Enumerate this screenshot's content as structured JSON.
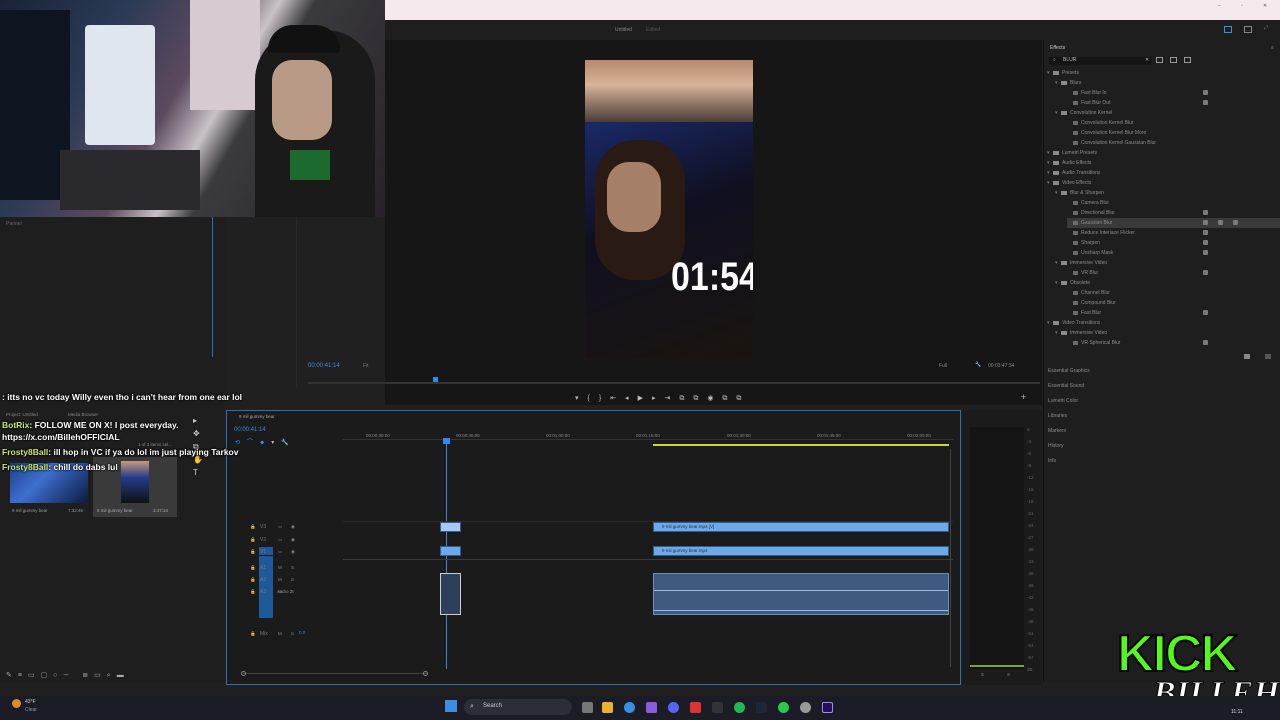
{
  "window": {
    "title": "Untitled",
    "subtitle": "Edited"
  },
  "program_monitor": {
    "timecode": "00:00:41:14",
    "fit_label": "Fit",
    "full_label": "Full",
    "duration": "00:03:47:34",
    "overlay_timer": "01:54"
  },
  "effects_panel": {
    "title": "Effects",
    "search_value": "BLUR",
    "items": [
      {
        "label": "Presets",
        "kind": "folder",
        "level": 0
      },
      {
        "label": "Blurs",
        "kind": "folder",
        "level": 1
      },
      {
        "label": "Fast Blur In",
        "kind": "item",
        "level": 2,
        "badge": true
      },
      {
        "label": "Fast Blur Out",
        "kind": "item",
        "level": 2,
        "badge": true
      },
      {
        "label": "Convolution Kernel",
        "kind": "folder",
        "level": 1
      },
      {
        "label": "Convolution Kernel Blur",
        "kind": "item",
        "level": 2
      },
      {
        "label": "Convolution Kernel Blur More",
        "kind": "item",
        "level": 2
      },
      {
        "label": "Convolution Kernel Gaussian Blur",
        "kind": "item",
        "level": 2
      },
      {
        "label": "Lumetri Presets",
        "kind": "folder",
        "level": 0
      },
      {
        "label": "Audio Effects",
        "kind": "folder",
        "level": 0
      },
      {
        "label": "Audio Transitions",
        "kind": "folder",
        "level": 0
      },
      {
        "label": "Video Effects",
        "kind": "folder",
        "level": 0
      },
      {
        "label": "Blur & Sharpen",
        "kind": "folder",
        "level": 1
      },
      {
        "label": "Camera Blur",
        "kind": "item",
        "level": 2
      },
      {
        "label": "Directional Blur",
        "kind": "item",
        "level": 2,
        "badge": true
      },
      {
        "label": "Gaussian Blur",
        "kind": "item",
        "level": 2,
        "badge": true,
        "selected": true
      },
      {
        "label": "Reduce Interlace Flicker",
        "kind": "item",
        "level": 2,
        "badge": true
      },
      {
        "label": "Sharpen",
        "kind": "item",
        "level": 2,
        "badge": true
      },
      {
        "label": "Unsharp Mask",
        "kind": "item",
        "level": 2,
        "badge": true
      },
      {
        "label": "Immersive Video",
        "kind": "folder",
        "level": 1
      },
      {
        "label": "VR Blur",
        "kind": "item",
        "level": 2,
        "badge": true
      },
      {
        "label": "Obsolete",
        "kind": "folder",
        "level": 1
      },
      {
        "label": "Channel Blur",
        "kind": "item",
        "level": 2
      },
      {
        "label": "Compound Blur",
        "kind": "item",
        "level": 2
      },
      {
        "label": "Fast Blur",
        "kind": "item",
        "level": 2,
        "badge": true
      },
      {
        "label": "Video Transitions",
        "kind": "folder",
        "level": 0
      },
      {
        "label": "Immersive Video",
        "kind": "folder",
        "level": 1
      },
      {
        "label": "VR Spherical Blur",
        "kind": "item",
        "level": 2,
        "badge": true
      }
    ]
  },
  "side_panels": [
    "Essential Graphics",
    "Essential Sound",
    "Lumetri Color",
    "Libraries",
    "Markers",
    "History",
    "Info"
  ],
  "project_panel": {
    "tabs": [
      "Project: Untitled",
      "Media Browser"
    ],
    "items_count": "1 of 3 items sel...",
    "bins": [
      {
        "name": "9 mil gummy bear",
        "duration": "7:32:46"
      },
      {
        "name": "9 mil gummy bear",
        "duration": "3:47:34"
      }
    ]
  },
  "panner_label": "Panner",
  "timeline": {
    "tab": "9 mil gummy bear",
    "timecode": "00:00:41:14",
    "ruler": [
      "00:00:30:00",
      "00:00:45:00",
      "00:01:00:00",
      "00:01:15:00",
      "00:01:30:00",
      "00:01:45:00",
      "00:02:00:00"
    ],
    "tracks": [
      "V3",
      "V2",
      "V1",
      "A1",
      "A2",
      "A3",
      "Mix"
    ],
    "audio_track_name": "Audio 2",
    "mix_value": "0.0",
    "clip_v2_label": "9 mil gummy bear.mp4 [V]",
    "clip_v1_label": "9 mil gummy bear.mp4"
  },
  "meters": {
    "scale": [
      "0",
      "-3",
      "-6",
      "-9",
      "-12",
      "-15",
      "-18",
      "-21",
      "-24",
      "-27",
      "-30",
      "-33",
      "-36",
      "-39",
      "-42",
      "-45",
      "-48",
      "-51",
      "-54",
      "-57",
      "dB"
    ],
    "bottom": [
      "S",
      "S"
    ]
  },
  "chat": [
    {
      "user": "",
      "msg": ": itts no vc today Willy even tho i can't hear from one ear lol"
    },
    {
      "user": "BotRix",
      "msg": ": FOLLOW ME ON X! I post everyday."
    },
    {
      "user": "",
      "msg": "https://x.com/BillehOFFICIAL"
    },
    {
      "user": "Frosty8Ball",
      "msg": ": ill hop in VC if ya do lol im just playing Tarkov"
    },
    {
      "user": "Frosty8Ball",
      "msg": ": chill do dabs lul"
    }
  ],
  "taskbar": {
    "weather_temp": "43°F",
    "weather_desc": "Clear",
    "search_placeholder": "Search",
    "clock": "11:11"
  },
  "brand": {
    "kick": "KICK",
    "name": "BILLEH"
  },
  "colors": {
    "accent_blue": "#2d8cf0",
    "clip_blue": "#6fa8e6",
    "kick_green": "#53fc18"
  }
}
